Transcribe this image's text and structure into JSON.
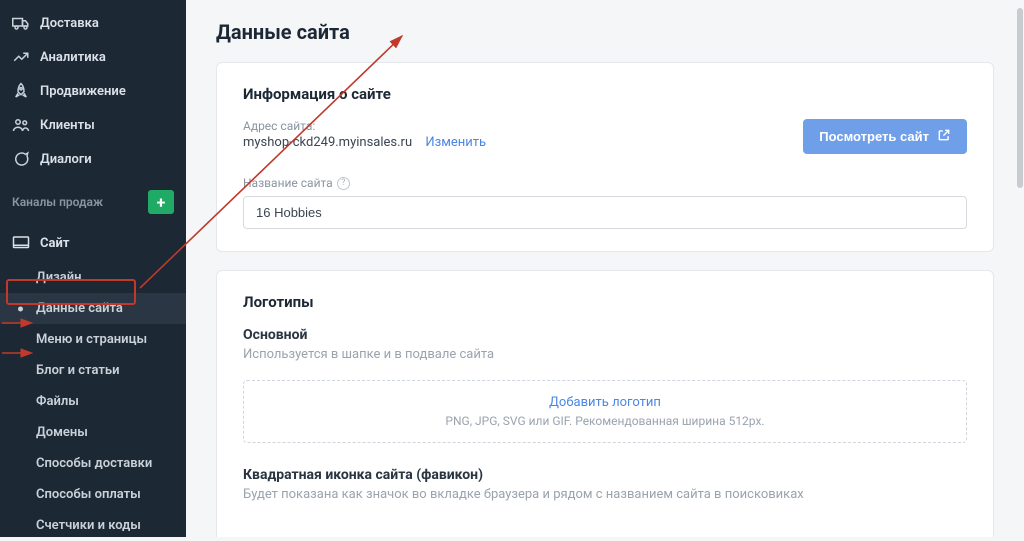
{
  "sidebar": {
    "nav": [
      {
        "label": "Доставка",
        "icon": "truck"
      },
      {
        "label": "Аналитика",
        "icon": "chart"
      },
      {
        "label": "Продвижение",
        "icon": "rocket"
      },
      {
        "label": "Клиенты",
        "icon": "users"
      },
      {
        "label": "Диалоги",
        "icon": "chat"
      }
    ],
    "sales_channels_label": "Каналы продаж",
    "add_btn": "+",
    "channel": {
      "label": "Сайт",
      "icon": "monitor"
    },
    "sub": [
      "Дизайн",
      "Данные сайта",
      "Меню и страницы",
      "Блог и статьи",
      "Файлы",
      "Домены",
      "Способы доставки",
      "Способы оплаты",
      "Счетчики и коды"
    ]
  },
  "main": {
    "page_title": "Данные сайта",
    "info_card": {
      "title": "Информация о сайте",
      "addr_label": "Адрес сайта:",
      "addr_value": "myshop-ckd249.myinsales.ru",
      "change_link": "Изменить",
      "view_button": "Посмотреть сайт",
      "name_label": "Название сайта",
      "name_value": "16 Hobbies"
    },
    "logos_card": {
      "title": "Логотипы",
      "primary_title": "Основной",
      "primary_desc": "Используется в шапке и в подвале сайта",
      "upload_link": "Добавить логотип",
      "upload_hint": "PNG, JPG, SVG или GIF. Рекомендованная ширина 512px.",
      "favicon_title": "Квадратная иконка сайта (фавикон)",
      "favicon_desc": "Будет показана как значок во вкладке браузера и рядом с названием сайта в поисковиках"
    }
  }
}
